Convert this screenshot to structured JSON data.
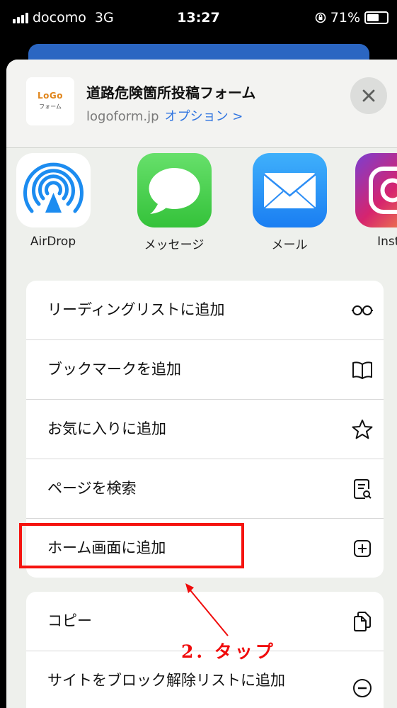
{
  "status_bar": {
    "carrier": "docomo",
    "network": "3G",
    "time": "13:27",
    "battery_percent": "71%",
    "battery_level": 0.71
  },
  "sheet": {
    "logo_text_top": "LoGo",
    "logo_text_bottom": "フォーム",
    "title": "道路危険箇所投稿フォーム",
    "domain": "logoform.jp",
    "options_label": "オプション >"
  },
  "apps": [
    {
      "label": "AirDrop",
      "icon": "airdrop-icon"
    },
    {
      "label": "メッセージ",
      "icon": "messages-icon"
    },
    {
      "label": "メール",
      "icon": "mail-icon"
    },
    {
      "label": "Insta",
      "icon": "instagram-icon"
    }
  ],
  "actions_group1": [
    {
      "label": "リーディングリストに追加",
      "icon": "glasses-icon"
    },
    {
      "label": "ブックマークを追加",
      "icon": "book-icon"
    },
    {
      "label": "お気に入りに追加",
      "icon": "star-icon"
    },
    {
      "label": "ページを検索",
      "icon": "find-in-page-icon"
    },
    {
      "label": "ホーム画面に追加",
      "icon": "add-square-icon"
    }
  ],
  "actions_group2": [
    {
      "label": "コピー",
      "icon": "copy-icon"
    },
    {
      "label": "サイトをブロック解除リストに追加",
      "icon": "minus-circle-icon"
    }
  ],
  "annotation": {
    "text": "2. タップ",
    "color": "#f00b0b"
  },
  "colors": {
    "accent": "#2f74e0",
    "highlight": "#f5140f"
  }
}
